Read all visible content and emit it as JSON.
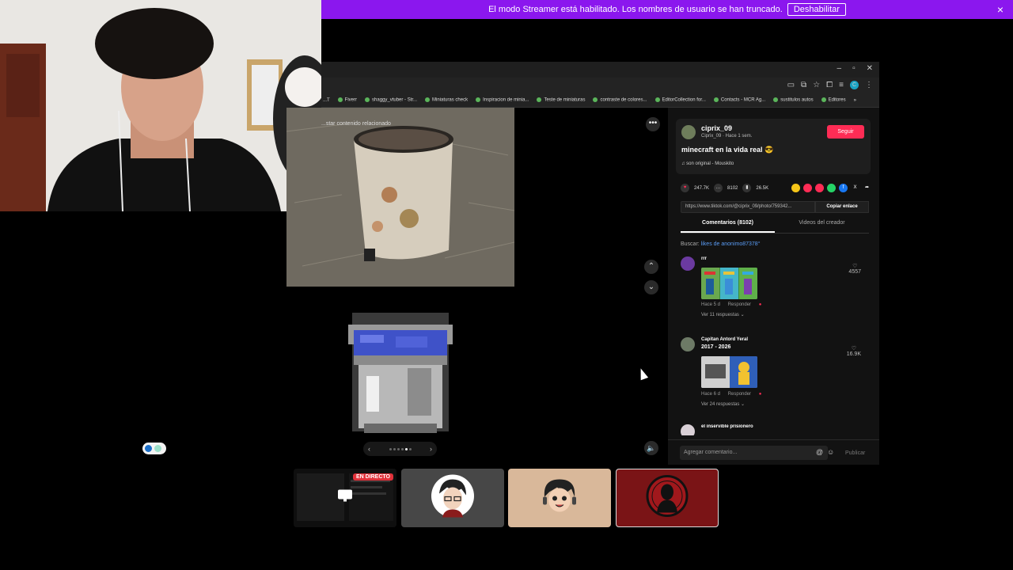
{
  "banner": {
    "message": "El modo Streamer está habilitado. Los nombres de usuario se han truncado.",
    "button": "Deshabilitar",
    "close_icon": "×"
  },
  "bookmarks": [
    "...T",
    "Fiverr",
    "shaggy_vtuber - Str...",
    "Miniaturas check",
    "Inspiracion de minia...",
    "Teste de miniaturas",
    "contraste de colores...",
    "EditorCollection for...",
    "Contacts - MCR Ag...",
    "sustitulos autos",
    "Editores"
  ],
  "viewer": {
    "related_text": "...star contenido relacionado"
  },
  "post": {
    "username": "ciprix_09",
    "subline": "Ciprix_09 · Hace 1 sem.",
    "follow": "Seguir",
    "caption": "minecraft en la vida real 😎",
    "music": "son original - Mouskito",
    "likes": "247.7K",
    "comments": "8102",
    "saves": "26.5K",
    "link": "https://www.tiktok.com/@ciprix_09/photo/759342...",
    "copy_link": "Copiar enlace"
  },
  "tabs": {
    "comments": "Comentarios (8102)",
    "creator_videos": "Videos del creador"
  },
  "search": {
    "label": "Buscar:",
    "query": "likes de anonimo87378"
  },
  "comments": [
    {
      "name": "rrr",
      "time": "Hace 5 d",
      "reply": "Responder",
      "replies": "Ver 11 respuestas",
      "likes": "4557"
    },
    {
      "name": "Capitan Antord Yeral",
      "text": "2017 - 2026",
      "time": "Hace 6 d",
      "reply": "Responder",
      "replies": "Ver 24 respuestas",
      "likes": "16.9K"
    },
    {
      "name": "el inservible prisionero"
    }
  ],
  "comment_box": {
    "placeholder": "Agregar comentario...",
    "publish": "Publicar"
  },
  "call": {
    "live_badge": "EN DIRECTO"
  }
}
